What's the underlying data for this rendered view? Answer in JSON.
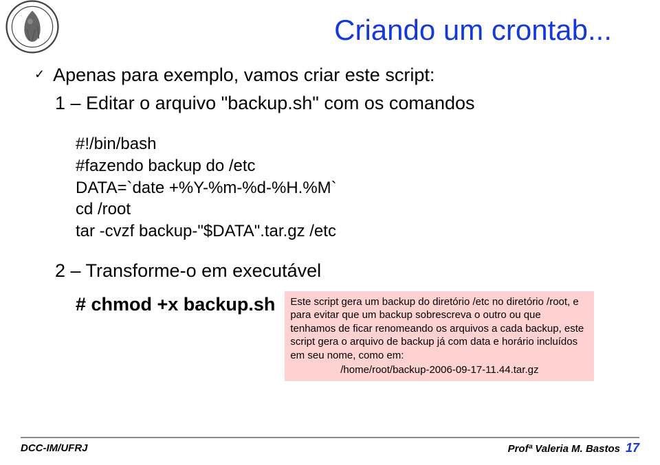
{
  "title": "Criando um crontab...",
  "bullet": "Apenas para exemplo, vamos criar este script:",
  "step1": "1 – Editar o arquivo \"backup.sh\" com os comandos",
  "code": {
    "l1": "#!/bin/bash",
    "l2": "#fazendo backup do /etc",
    "l3": "DATA=`date +%Y-%m-%d-%H.%M`",
    "l4": "cd /root",
    "l5": "tar -cvzf  backup-\"$DATA\".tar.gz  /etc"
  },
  "step2": "2 – Transforme-o em executável",
  "cmd": "# chmod +x backup.sh",
  "note": {
    "line1": "Este script gera um backup do diretório  /etc no diretório /root, e para evitar que um backup sobrescreva o outro ou que tenhamos de ficar renomeando os arquivos a cada backup, este script gera o arquivo de backup já com data e horário incluídos em seu nome, como em:",
    "path": "/home/root/backup-2006-09-17-11.44.tar.gz"
  },
  "footer": {
    "left": "DCC-IM/UFRJ",
    "right": "Profª Valeria M. Bastos",
    "page": "17"
  }
}
